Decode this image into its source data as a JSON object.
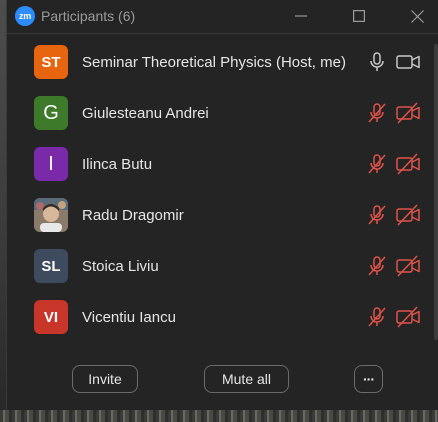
{
  "window": {
    "app_logo": "zm",
    "title": "Participants (6)",
    "controls": [
      "minimize-icon",
      "maximize-icon",
      "close-icon"
    ]
  },
  "participants": [
    {
      "initials": "ST",
      "name": "Seminar Theoretical Physics (Host, me)",
      "avatar_color": "#e8650f",
      "mic": "on",
      "camera": "off-neutral",
      "avatar_type": "initials"
    },
    {
      "initials": "G",
      "name": "Giulesteanu Andrei",
      "avatar_color": "#3d7a2a",
      "mic": "muted",
      "camera": "off",
      "avatar_type": "initials-big"
    },
    {
      "initials": "I",
      "name": "Ilinca Butu",
      "avatar_color": "#7a2aa8",
      "mic": "muted",
      "camera": "off",
      "avatar_type": "initials-big"
    },
    {
      "initials": "",
      "name": "Radu Dragomir",
      "avatar_color": "#6b6b6b",
      "mic": "muted",
      "camera": "off",
      "avatar_type": "photo"
    },
    {
      "initials": "SL",
      "name": "Stoica Liviu",
      "avatar_color": "#3e4b5e",
      "mic": "muted",
      "camera": "off",
      "avatar_type": "initials"
    },
    {
      "initials": "VI",
      "name": "Vicentiu Iancu",
      "avatar_color": "#c8362a",
      "mic": "muted",
      "camera": "off",
      "avatar_type": "initials"
    }
  ],
  "footer": {
    "invite_label": "Invite",
    "mute_all_label": "Mute all",
    "more_label": "···"
  },
  "colors": {
    "muted_red": "#e0534a",
    "icon_gray": "#c8c8c8"
  }
}
